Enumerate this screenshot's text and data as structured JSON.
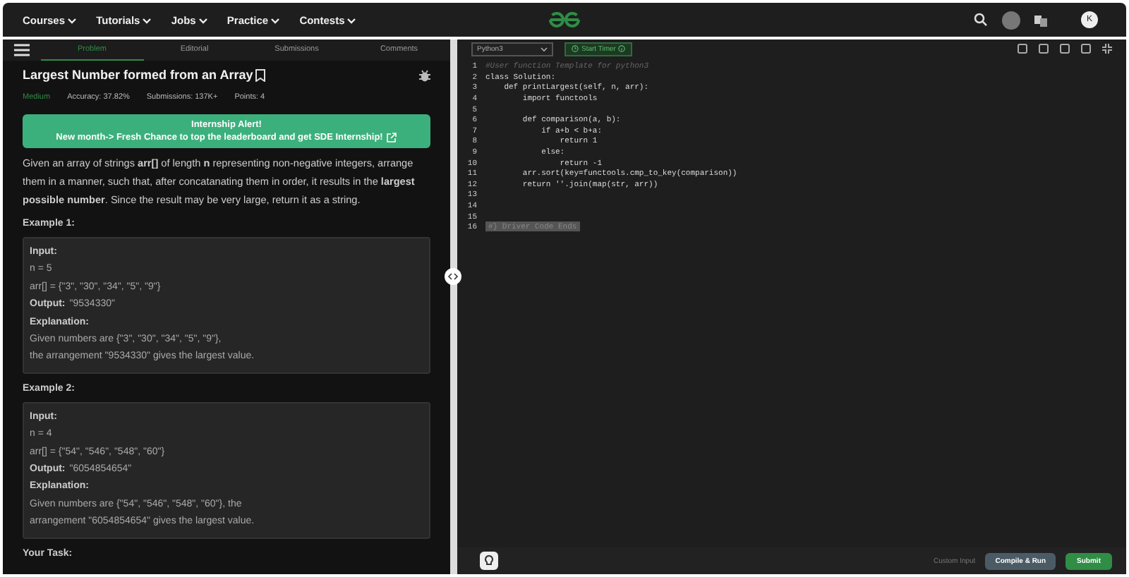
{
  "nav": {
    "menus": [
      "Courses",
      "Tutorials",
      "Jobs",
      "Practice",
      "Contests"
    ],
    "avatar": "K"
  },
  "tabs": [
    {
      "label": "Problem",
      "selected": true
    },
    {
      "label": "Editorial",
      "selected": false
    },
    {
      "label": "Submissions",
      "selected": false
    },
    {
      "label": "Comments",
      "selected": false
    }
  ],
  "problem": {
    "title": "Largest Number formed from an Array",
    "difficulty": "Medium",
    "accuracy": "Accuracy: 37.82%",
    "submissions": "Submissions: 137K+",
    "points": "Points: 4"
  },
  "alert": {
    "title": "Internship Alert!",
    "text": "New month-> Fresh Chance to top the leaderboard and get SDE Internship!"
  },
  "description": "Given an array of strings **arr[]** of length **n** representing non-negative integers, arrange them in a manner, such that, after concatanating them in order, it results in the **largest possible number**. Since the result may be very large, return it as a string.",
  "examples": [
    {
      "heading": "Example 1:",
      "lines": [
        {
          "kind": "label",
          "text": "Input:"
        },
        {
          "kind": "text",
          "text": "n = 5"
        },
        {
          "kind": "text",
          "text": "arr[] =  {\"3\", \"30\", \"34\", \"5\", \"9\"}"
        },
        {
          "kind": "labeled",
          "label": "Output:",
          "text": "\"9534330\""
        },
        {
          "kind": "label",
          "text": "Explanation:"
        },
        {
          "kind": "text",
          "text": "Given numbers are  {\"3\", \"30\", \"34\", \"5\", \"9\"},"
        },
        {
          "kind": "text",
          "text": "the arrangement \"9534330\" gives the largest value."
        }
      ]
    },
    {
      "heading": "Example 2:",
      "lines": [
        {
          "kind": "label",
          "text": "Input:"
        },
        {
          "kind": "text",
          "text": "n = 4"
        },
        {
          "kind": "text",
          "text": "arr[] =  {\"54\", \"546\", \"548\", \"60\"}"
        },
        {
          "kind": "labeled",
          "label": "Output:",
          "text": "\"6054854654\""
        },
        {
          "kind": "label",
          "text": "Explanation:"
        },
        {
          "kind": "text",
          "text": "Given numbers are {\"54\", \"546\", \"548\", \"60\"}, the"
        },
        {
          "kind": "text",
          "text": "arrangement \"6054854654\" gives the largest value."
        }
      ]
    }
  ],
  "next_heading": "Your Task:",
  "editor": {
    "language": "Python3",
    "timer": "Start Timer",
    "lines": [
      {
        "no": "1",
        "kind": "comment",
        "text": "#User function Template for python3"
      },
      {
        "no": "2",
        "kind": "code",
        "text": "class Solution:"
      },
      {
        "no": "3",
        "kind": "code",
        "text": "    def printLargest(self, n, arr):"
      },
      {
        "no": "4",
        "kind": "code",
        "text": "        import functools"
      },
      {
        "no": "5",
        "kind": "code"
      },
      {
        "no": "6",
        "kind": "code",
        "text": "        def comparison(a, b):"
      },
      {
        "no": "7",
        "kind": "code",
        "text": "            if a+b < b+a:"
      },
      {
        "no": "8",
        "kind": "code",
        "text": "                return 1"
      },
      {
        "no": "9",
        "kind": "code",
        "text": "            else:"
      },
      {
        "no": "10",
        "kind": "code",
        "text": "                return -1"
      },
      {
        "no": "11",
        "kind": "code",
        "text": "        arr.sort(key=functools.cmp_to_key(comparison))"
      },
      {
        "no": "12",
        "kind": "code",
        "text": "        return ''.join(map(str, arr))"
      },
      {
        "no": "13",
        "kind": "code"
      },
      {
        "no": "14",
        "kind": "code"
      },
      {
        "no": "15",
        "kind": "code"
      },
      {
        "no": "16",
        "kind": "folded",
        "text": "#} Driver Code Ends"
      }
    ]
  },
  "footer": {
    "custom_input": "Custom Input",
    "compile": "Compile & Run",
    "submit": "Submit"
  }
}
